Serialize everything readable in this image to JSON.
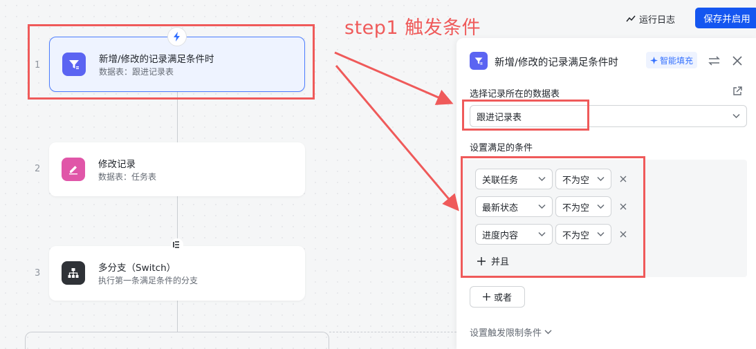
{
  "annotation": {
    "label": "step1 触发条件",
    "color": "#ef5a5a"
  },
  "toolbar": {
    "log_label": "运行日志",
    "save_label": "保存并启用",
    "save_color": "#1456f0"
  },
  "flow": {
    "nodes": [
      {
        "index": "1",
        "title": "新增/修改的记录满足条件时",
        "subtitle": "数据表：跟进记录表",
        "icon": "filter-icon",
        "icon_color": "#5b64f2",
        "selected": true
      },
      {
        "index": "2",
        "title": "修改记录",
        "subtitle": "数据表：任务表",
        "icon": "edit-icon",
        "icon_color": "#e056a8",
        "selected": false
      },
      {
        "index": "3",
        "title": "多分支（Switch）",
        "subtitle": "执行第一条满足条件的分支",
        "icon": "branch-icon",
        "icon_color": "#2f3237",
        "selected": false
      }
    ],
    "badges": [
      "lightning-icon",
      "switch-connector-icon"
    ]
  },
  "panel": {
    "title": "新增/修改的记录满足条件时",
    "smart_fill_label": "智能填充",
    "table_section_label": "选择记录所在的数据表",
    "table_value": "跟进记录表",
    "conditions_label": "设置满足的条件",
    "conditions": [
      {
        "field": "关联任务",
        "operator": "不为空"
      },
      {
        "field": "最新状态",
        "operator": "不为空"
      },
      {
        "field": "进度内容",
        "operator": "不为空"
      }
    ],
    "and_label": "并且",
    "or_label": "或者",
    "limit_label": "设置触发限制条件",
    "accent": "#3370ff"
  }
}
